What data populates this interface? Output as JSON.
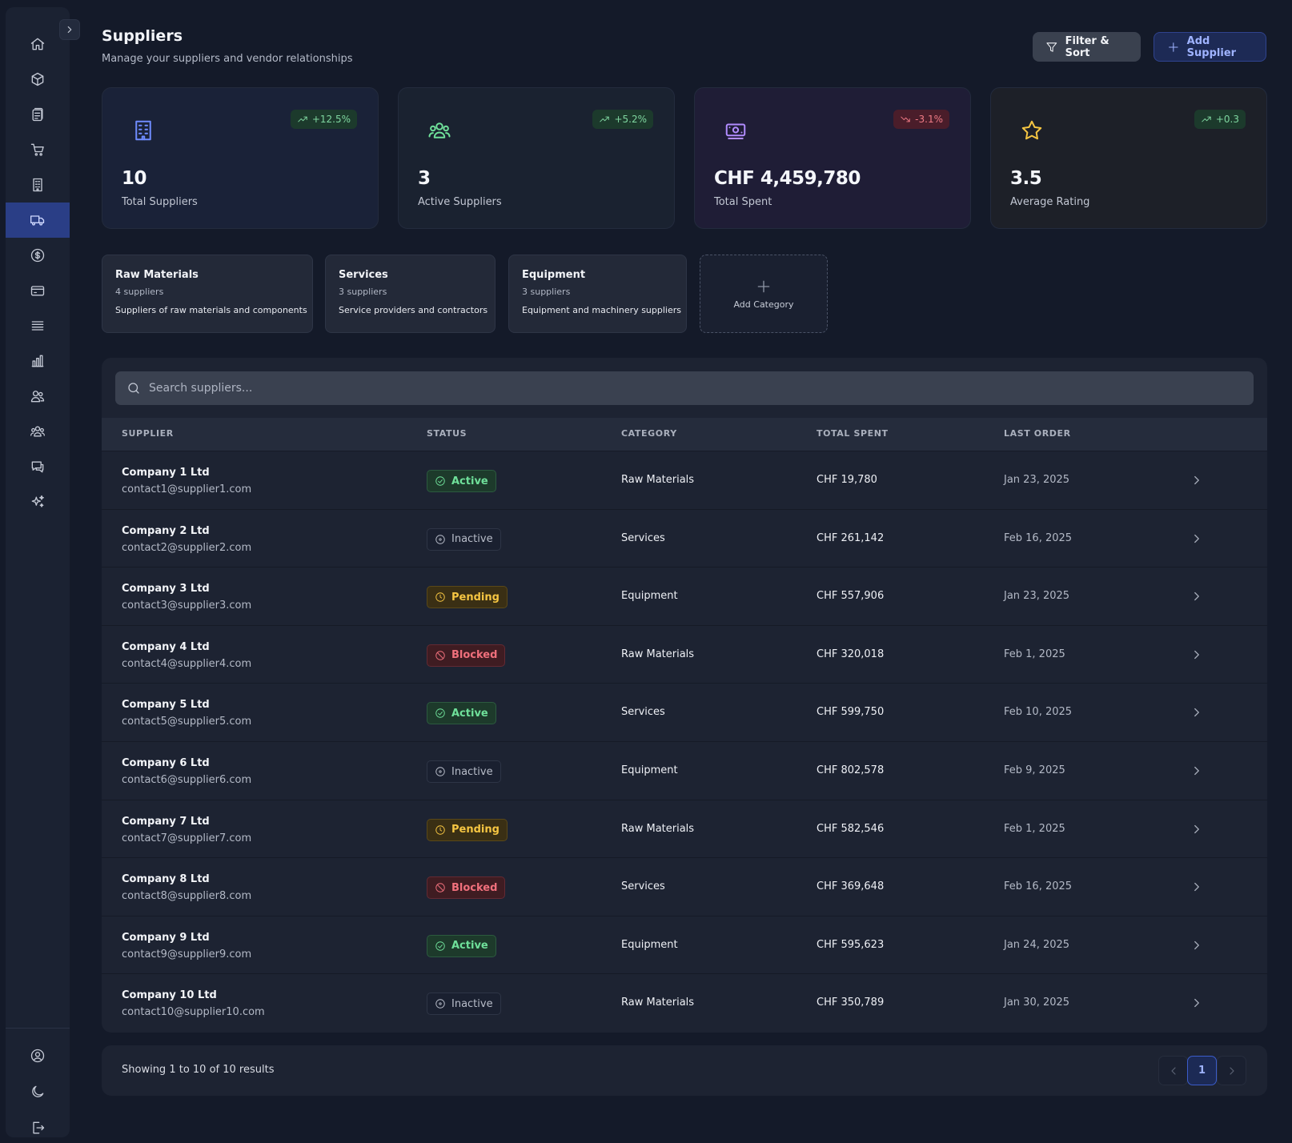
{
  "header": {
    "title": "Suppliers",
    "subtitle": "Manage your suppliers and vendor relationships",
    "filter_label": "Filter & Sort",
    "add_label": "Add Supplier"
  },
  "colors": {
    "accent": "#2a3e86",
    "active": "#6fe09a",
    "pending": "#f5c542",
    "blocked": "#f0707c",
    "trend_up": "#7fd6a0",
    "trend_down": "#f07b86"
  },
  "sidebar": {
    "items": [
      {
        "icon": "home-icon"
      },
      {
        "icon": "box-icon"
      },
      {
        "icon": "clipboard-icon"
      },
      {
        "icon": "cart-icon"
      },
      {
        "icon": "building-icon"
      },
      {
        "icon": "truck-icon",
        "active": true
      },
      {
        "icon": "dollar-icon"
      },
      {
        "icon": "credit-card-icon"
      },
      {
        "icon": "list-icon"
      },
      {
        "icon": "bar-chart-icon"
      },
      {
        "icon": "users-icon"
      },
      {
        "icon": "team-icon"
      },
      {
        "icon": "chat-icon"
      },
      {
        "icon": "sparkles-icon"
      }
    ],
    "bottom": [
      {
        "icon": "user-circle-icon"
      },
      {
        "icon": "moon-icon"
      },
      {
        "icon": "logout-icon"
      }
    ]
  },
  "stats": [
    {
      "value": "10",
      "label": "Total Suppliers",
      "trend": "+12.5%",
      "trend_dir": "up",
      "icon": "building-icon"
    },
    {
      "value": "3",
      "label": "Active Suppliers",
      "trend": "+5.2%",
      "trend_dir": "up",
      "icon": "users-icon"
    },
    {
      "value": "CHF 4,459,780",
      "label": "Total Spent",
      "trend": "-3.1%",
      "trend_dir": "down",
      "icon": "money-icon"
    },
    {
      "value": "3.5",
      "label": "Average Rating",
      "trend": "+0.3",
      "trend_dir": "up",
      "icon": "star-icon"
    }
  ],
  "categories": [
    {
      "name": "Raw Materials",
      "count": "4 suppliers",
      "description": "Suppliers of raw materials and components"
    },
    {
      "name": "Services",
      "count": "3 suppliers",
      "description": "Service providers and contractors"
    },
    {
      "name": "Equipment",
      "count": "3 suppliers",
      "description": "Equipment and machinery suppliers"
    }
  ],
  "add_category_label": "Add Category",
  "search": {
    "placeholder": "Search suppliers..."
  },
  "table": {
    "columns": [
      "SUPPLIER",
      "STATUS",
      "CATEGORY",
      "TOTAL SPENT",
      "LAST ORDER"
    ],
    "rows": [
      {
        "name": "Company 1 Ltd",
        "email": "contact1@supplier1.com",
        "status": "Active",
        "category": "Raw Materials",
        "spent": "CHF 19,780",
        "last_order": "Jan 23, 2025"
      },
      {
        "name": "Company 2 Ltd",
        "email": "contact2@supplier2.com",
        "status": "Inactive",
        "category": "Services",
        "spent": "CHF 261,142",
        "last_order": "Feb 16, 2025"
      },
      {
        "name": "Company 3 Ltd",
        "email": "contact3@supplier3.com",
        "status": "Pending",
        "category": "Equipment",
        "spent": "CHF 557,906",
        "last_order": "Jan 23, 2025"
      },
      {
        "name": "Company 4 Ltd",
        "email": "contact4@supplier4.com",
        "status": "Blocked",
        "category": "Raw Materials",
        "spent": "CHF 320,018",
        "last_order": "Feb 1, 2025"
      },
      {
        "name": "Company 5 Ltd",
        "email": "contact5@supplier5.com",
        "status": "Active",
        "category": "Services",
        "spent": "CHF 599,750",
        "last_order": "Feb 10, 2025"
      },
      {
        "name": "Company 6 Ltd",
        "email": "contact6@supplier6.com",
        "status": "Inactive",
        "category": "Equipment",
        "spent": "CHF 802,578",
        "last_order": "Feb 9, 2025"
      },
      {
        "name": "Company 7 Ltd",
        "email": "contact7@supplier7.com",
        "status": "Pending",
        "category": "Raw Materials",
        "spent": "CHF 582,546",
        "last_order": "Feb 1, 2025"
      },
      {
        "name": "Company 8 Ltd",
        "email": "contact8@supplier8.com",
        "status": "Blocked",
        "category": "Services",
        "spent": "CHF 369,648",
        "last_order": "Feb 16, 2025"
      },
      {
        "name": "Company 9 Ltd",
        "email": "contact9@supplier9.com",
        "status": "Active",
        "category": "Equipment",
        "spent": "CHF 595,623",
        "last_order": "Jan 24, 2025"
      },
      {
        "name": "Company 10 Ltd",
        "email": "contact10@supplier10.com",
        "status": "Inactive",
        "category": "Raw Materials",
        "spent": "CHF 350,789",
        "last_order": "Jan 30, 2025"
      }
    ]
  },
  "pagination": {
    "showing": "Showing 1 to 10 of 10 results",
    "current_page": "1"
  }
}
